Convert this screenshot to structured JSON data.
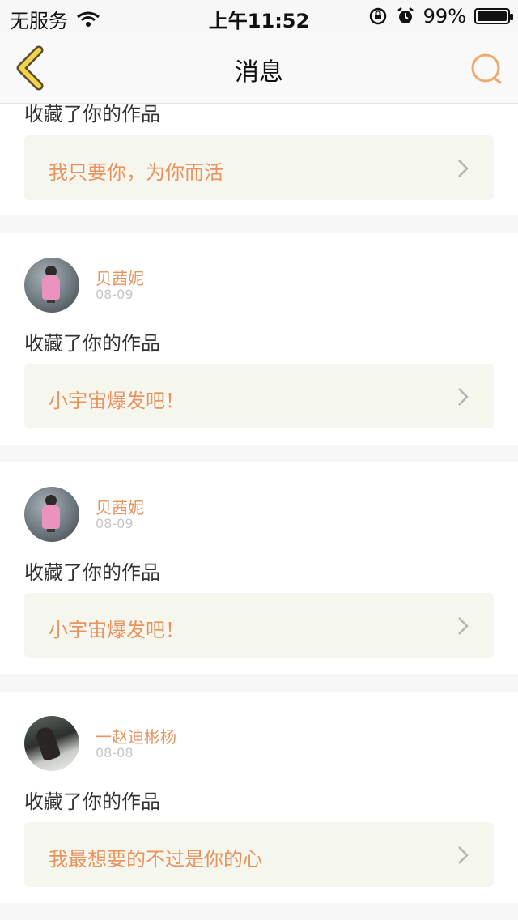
{
  "status_bar": {
    "carrier": "无服务",
    "time": "上午11:52",
    "battery_percent": "99%",
    "battery_level": 0.99,
    "icons": [
      "wifi-icon",
      "orientation-lock-icon",
      "alarm-icon",
      "battery-icon"
    ]
  },
  "nav": {
    "title": "消息",
    "back_icon": "back-chevron-icon",
    "search_icon": "search-icon"
  },
  "colors": {
    "accent": "#e8935d",
    "back_icon": "#e8c43a",
    "box_bg": "#f5f6ee",
    "page_bg": "#f7f7f7"
  },
  "messages": [
    {
      "action": "收藏了你的作品",
      "work_title": "我只要你，为你而活"
    },
    {
      "username": "贝茜妮",
      "date": "08-09",
      "action": "收藏了你的作品",
      "work_title": "小宇宙爆发吧！"
    },
    {
      "username": "贝茜妮",
      "date": "08-09",
      "action": "收藏了你的作品",
      "work_title": "小宇宙爆发吧！"
    },
    {
      "username": "一赵迪彬杨",
      "date": "08-08",
      "action": "收藏了你的作品",
      "work_title": "我最想要的不过是你的心"
    }
  ]
}
